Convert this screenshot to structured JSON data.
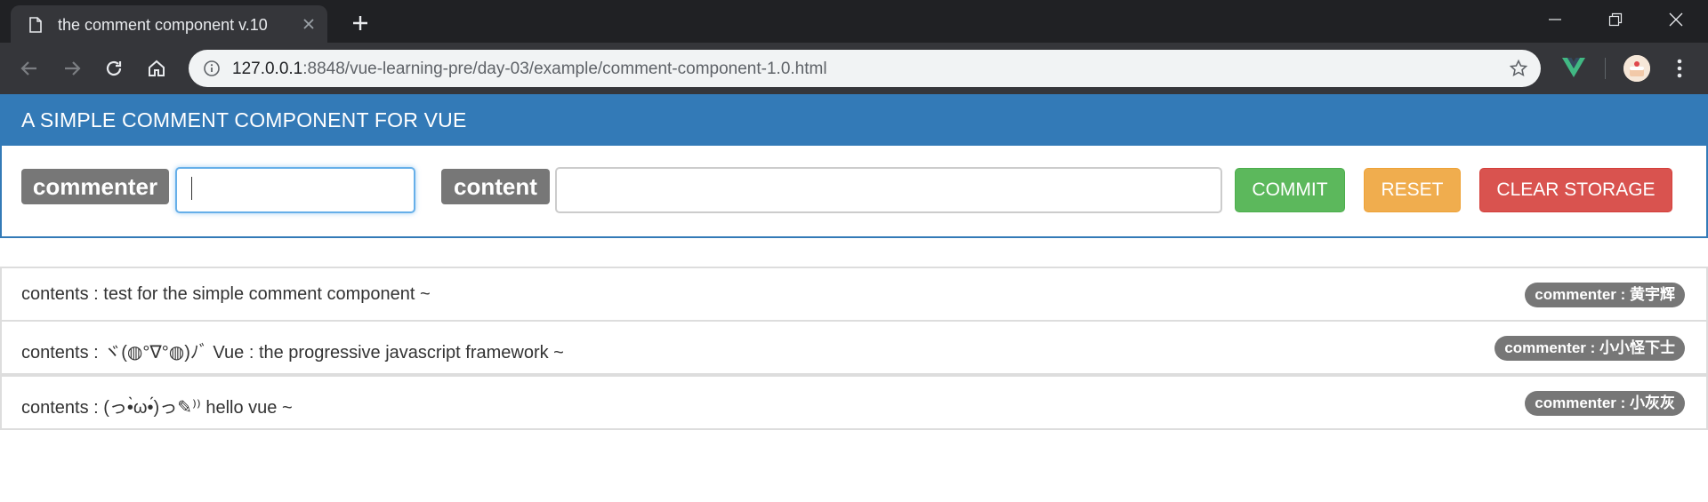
{
  "browser": {
    "tab_title": "the comment component v.10",
    "url_host": "127.0.0.1",
    "url_rest": ":8848/vue-learning-pre/day-03/example/comment-component-1.0.html"
  },
  "header": {
    "title": "A SIMPLE COMMENT COMPONENT FOR VUE"
  },
  "form": {
    "commenter_label": "commenter",
    "commenter_value": "",
    "content_label": "content",
    "content_value": "",
    "commit_label": "COMMIT",
    "reset_label": "RESET",
    "clear_label": "CLEAR STORAGE"
  },
  "comments": [
    {
      "text": "contents : test for the simple comment component ~",
      "badge": "commenter : 黄宇辉"
    },
    {
      "text": "contents : ヾ(◍°∇°◍)ﾉﾞ Vue : the progressive javascript framework ~",
      "badge": "commenter : 小小怪下士"
    },
    {
      "text": "contents : (っ•̀ω•́)っ✎⁾⁾ hello vue ~",
      "badge": "commenter : 小灰灰"
    }
  ],
  "colors": {
    "primary": "#337ab7",
    "success": "#5cb85c",
    "warning": "#f0ad4e",
    "danger": "#d9534f",
    "label": "#777777"
  }
}
